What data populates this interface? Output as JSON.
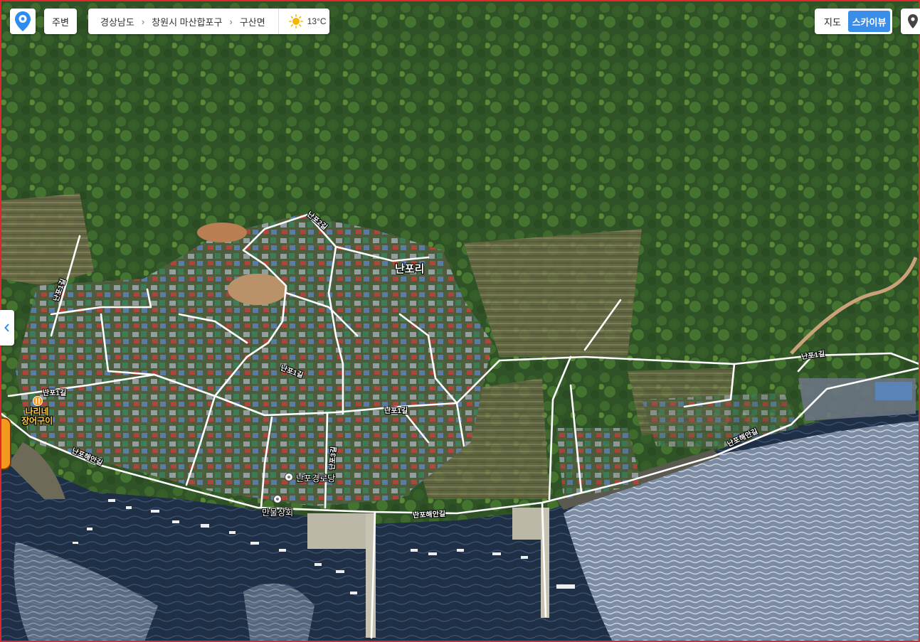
{
  "toolbar": {
    "logo_icon": "location-pin-logo-icon",
    "around_label": "주변"
  },
  "breadcrumb": {
    "items": [
      "경상남도",
      "창원시 마산합포구",
      "구산면"
    ]
  },
  "weather": {
    "icon": "sun-icon",
    "temperature": "13°C"
  },
  "map_type": {
    "map_label": "지도",
    "skyview_label": "스카이뷰",
    "active": "스카이뷰"
  },
  "map_labels": {
    "village": "난포리",
    "roads": {
      "nanpo1_a": "난포1길",
      "nanpo1_b": "난포1길",
      "nanpo1_c": "난포1길",
      "nanpo1_d": "난포1길",
      "nanpo1_e": "난포1길",
      "nanpo2": "난포2길",
      "nanpo3": "난포3길",
      "coast_a": "난포해안길",
      "coast_b": "난포해안길",
      "coast_c": "난포해안길"
    },
    "pois": {
      "senior_center": "난포경로당",
      "store": "만물상회",
      "restaurant_line1": "나리네",
      "restaurant_line2": "장어구이"
    }
  },
  "colors": {
    "skyview_active": "#3a8ee8",
    "frame_border": "#e0262a",
    "restaurant": "#f39a1e"
  }
}
